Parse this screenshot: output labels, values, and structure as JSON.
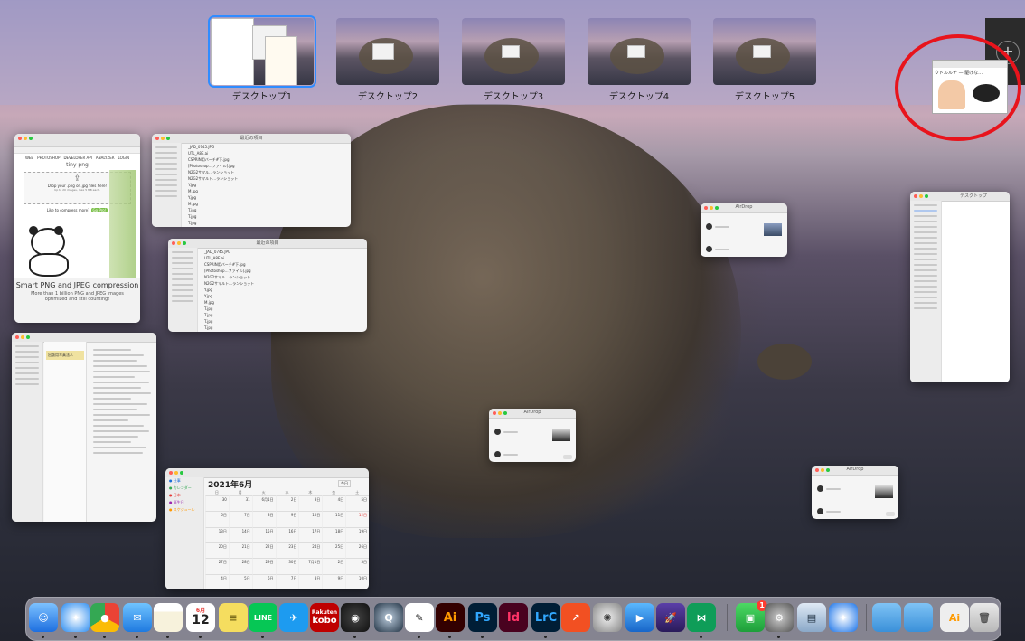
{
  "mission_control": {
    "spaces": [
      {
        "label": "デスクトップ1",
        "active": true
      },
      {
        "label": "デスクトップ2",
        "active": false
      },
      {
        "label": "デスクトップ3",
        "active": false
      },
      {
        "label": "デスクトップ4",
        "active": false
      },
      {
        "label": "デスクトップ5",
        "active": false
      }
    ],
    "add_space": "+",
    "dragged_window_text": "クドルルチ — 駆けな…"
  },
  "windows": {
    "tinypng": {
      "brand": "tiny png",
      "nav": [
        "WEB",
        "PHOTOSHOP",
        "DEVELOPER API",
        "ANALYZER",
        "LOGIN"
      ],
      "drop_text": "Drop your .png or .jpg files here!",
      "drop_sub": "Up to 20 images, max 5 MB each.",
      "compress_more": "Like to compress more?",
      "go_pro": "Go Pro!",
      "headline": "Smart PNG and JPEG compression",
      "sub": "More than 1 billion PNG and JPEG images optimized and still counting!"
    },
    "finder1": {
      "title": "最近の項目",
      "files": [
        "_JAD_0745.JPG",
        "UTL_A8E.ai",
        "CSPRIN用バーチ#下.jpg",
        "[Photoshop…ファイル].jpg",
        "N2G2サマル…ランショット",
        "N2G2サマルト…ランショット",
        "Y.jpg",
        "M.jpg",
        "Y.jpg",
        "M.jpg",
        "T.jpg",
        "T.jpg",
        "T.jpg",
        "T.jpg",
        "T.jpg",
        "T.jpg"
      ]
    },
    "finder2": {
      "title": "最近の項目",
      "files": [
        "_JAD_0745.JPG",
        "UTL_A8E.ai",
        "CSPRIN用バーチ#下.jpg",
        "[Photoshop…ファイル].jpg",
        "N2G2サマル…ランショット",
        "N2G2サマルト…ランショット",
        "Y.jpg",
        "Y.jpg",
        "M.jpg",
        "T.jpg",
        "T.jpg",
        "T.jpg",
        "T.jpg",
        "T.jpg",
        "T.jpg",
        "T.jpg"
      ]
    },
    "notes": {
      "title": "出版用写真法人"
    },
    "calendar": {
      "title": "2021年6月",
      "today_label": "今日",
      "weekdays": [
        "日",
        "月",
        "火",
        "水",
        "木",
        "金",
        "土"
      ],
      "day_numbers": [
        "30",
        "31",
        "6月1日",
        "2日",
        "3日",
        "4日",
        "5日",
        "6日",
        "7日",
        "8日",
        "9日",
        "10日",
        "11日",
        "12日",
        "13日",
        "14日",
        "15日",
        "16日",
        "17日",
        "18日",
        "19日",
        "20日",
        "21日",
        "22日",
        "23日",
        "24日",
        "25日",
        "26日",
        "27日",
        "28日",
        "29日",
        "30日",
        "7月1日",
        "2日",
        "3日",
        "4日",
        "5日",
        "6日",
        "7日",
        "8日",
        "9日",
        "10日"
      ]
    },
    "airdrop": {
      "title": "AirDrop"
    },
    "finder_right": {
      "title": "デスクトップ"
    }
  },
  "dock": {
    "calendar_month": "6月",
    "calendar_day": "12",
    "facetime_badge": "1",
    "apps": [
      "Finder",
      "Safari",
      "Chrome",
      "Mail",
      "Notes",
      "Calendar",
      "Stickies",
      "LINE",
      "Twitter",
      "Rakuten Kobo",
      "OBS",
      "QuickTime",
      "Clip Studio",
      "Illustrator",
      "Photoshop",
      "InDesign",
      "Lightroom Classic",
      "Grapher",
      "Mixer",
      "Screenflow",
      "Rocket",
      "Monitor",
      "FaceTime",
      "System Preferences",
      "Preview",
      "Safari TP",
      "Folder",
      "Folder",
      "Illustrator File",
      "Trash"
    ],
    "labels": {
      "kobo_top": "Rakuten",
      "kobo_bottom": "kobo",
      "ai": "Ai",
      "ps": "Ps",
      "id": "Id",
      "lrc": "LrC",
      "line": "LINE"
    }
  }
}
